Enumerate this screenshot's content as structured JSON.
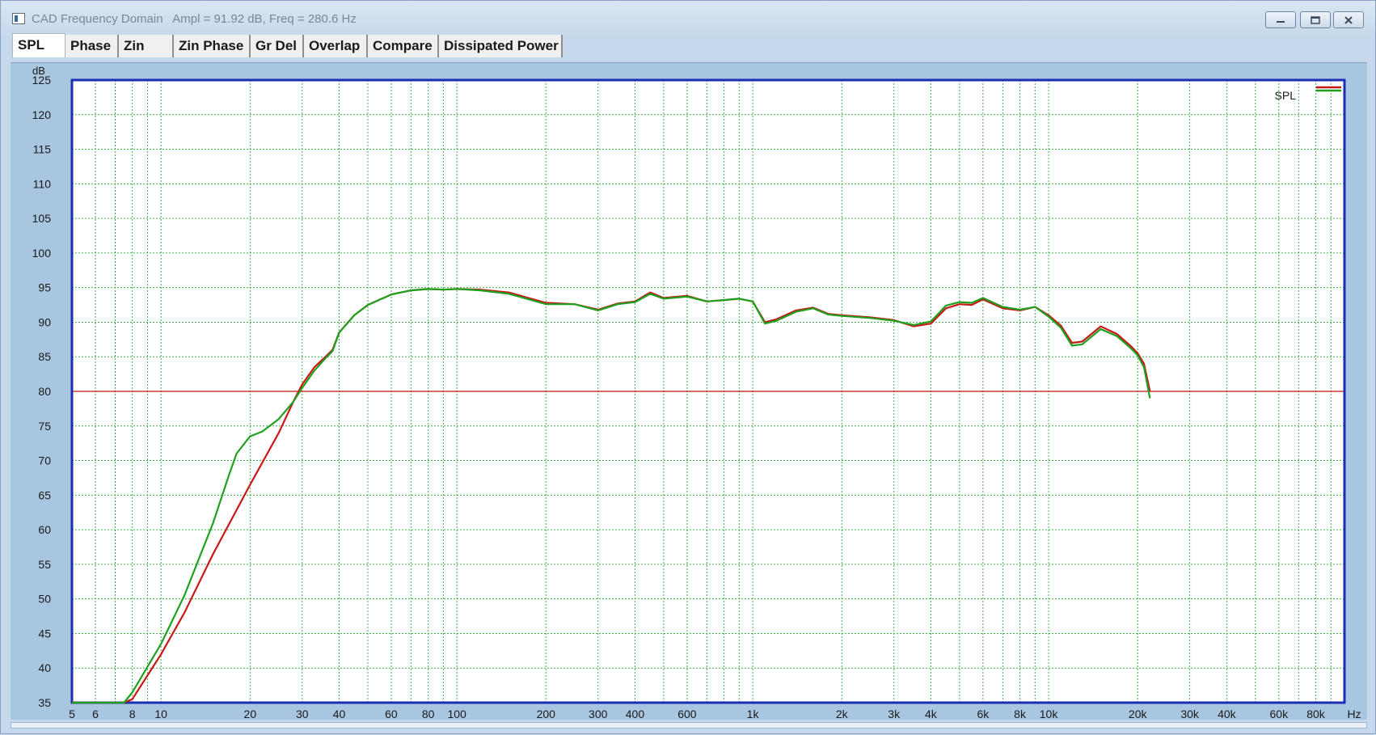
{
  "window": {
    "title": "CAD Frequency Domain   Ampl = 91.92 dB, Freq = 280.6 Hz"
  },
  "icons": {
    "app": "app-window-icon",
    "minimize": "minimize-icon",
    "maximize": "maximize-icon",
    "close": "close-icon"
  },
  "colors": {
    "background": "#a9c6e0",
    "grid": "#3cb043",
    "frame": "#1b2fb0",
    "reference_line": "#c01010",
    "series_red": "#c81818",
    "series_green": "#1fa01f"
  },
  "tabs": [
    {
      "label": "SPL",
      "active": true
    },
    {
      "label": "Phase",
      "active": false
    },
    {
      "label": "Zin",
      "active": false
    },
    {
      "label": "Zin Phase",
      "active": false
    },
    {
      "label": "Gr Del",
      "active": false
    },
    {
      "label": "Overlap",
      "active": false
    },
    {
      "label": "Compare",
      "active": false
    },
    {
      "label": "Dissipated Power",
      "active": false
    }
  ],
  "chart_data": {
    "type": "line",
    "title": "",
    "ylabel": "dB",
    "xlabel": "Hz",
    "x_scale": "log",
    "xlim": [
      5,
      100000
    ],
    "ylim": [
      35,
      125
    ],
    "grid": true,
    "legend_position": "top-right",
    "legend_label": "SPL",
    "x_ticks": [
      {
        "value": 5,
        "label": "5"
      },
      {
        "value": 6,
        "label": "6"
      },
      {
        "value": 8,
        "label": "8"
      },
      {
        "value": 10,
        "label": "10"
      },
      {
        "value": 20,
        "label": "20"
      },
      {
        "value": 30,
        "label": "30"
      },
      {
        "value": 40,
        "label": "40"
      },
      {
        "value": 60,
        "label": "60"
      },
      {
        "value": 80,
        "label": "80"
      },
      {
        "value": 100,
        "label": "100"
      },
      {
        "value": 200,
        "label": "200"
      },
      {
        "value": 300,
        "label": "300"
      },
      {
        "value": 400,
        "label": "400"
      },
      {
        "value": 600,
        "label": "600"
      },
      {
        "value": 1000,
        "label": "1k"
      },
      {
        "value": 2000,
        "label": "2k"
      },
      {
        "value": 3000,
        "label": "3k"
      },
      {
        "value": 4000,
        "label": "4k"
      },
      {
        "value": 6000,
        "label": "6k"
      },
      {
        "value": 8000,
        "label": "8k"
      },
      {
        "value": 10000,
        "label": "10k"
      },
      {
        "value": 20000,
        "label": "20k"
      },
      {
        "value": 30000,
        "label": "30k"
      },
      {
        "value": 40000,
        "label": "40k"
      },
      {
        "value": 60000,
        "label": "60k"
      },
      {
        "value": 80000,
        "label": "80k"
      }
    ],
    "y_ticks": [
      35,
      40,
      45,
      50,
      55,
      60,
      65,
      70,
      75,
      80,
      85,
      90,
      95,
      100,
      105,
      110,
      115,
      120,
      125
    ],
    "reference_line": {
      "y": 80
    },
    "series": [
      {
        "color": "#c81818",
        "points": [
          [
            5,
            35
          ],
          [
            7.5,
            35
          ],
          [
            8,
            35.5
          ],
          [
            10,
            42
          ],
          [
            12,
            48
          ],
          [
            15,
            56.5
          ],
          [
            20,
            66.5
          ],
          [
            25,
            74
          ],
          [
            28,
            78.5
          ],
          [
            30,
            81
          ],
          [
            33,
            83.5
          ],
          [
            36,
            85
          ],
          [
            38,
            86
          ],
          [
            40,
            88.5
          ],
          [
            45,
            91
          ],
          [
            50,
            92.5
          ],
          [
            60,
            94
          ],
          [
            70,
            94.6
          ],
          [
            80,
            94.8
          ],
          [
            90,
            94.7
          ],
          [
            100,
            94.8
          ],
          [
            120,
            94.7
          ],
          [
            150,
            94.3
          ],
          [
            200,
            92.8
          ],
          [
            250,
            92.6
          ],
          [
            300,
            91.8
          ],
          [
            350,
            92.7
          ],
          [
            400,
            93
          ],
          [
            450,
            94.3
          ],
          [
            500,
            93.5
          ],
          [
            600,
            93.8
          ],
          [
            700,
            93
          ],
          [
            800,
            93.2
          ],
          [
            900,
            93.4
          ],
          [
            1000,
            93
          ],
          [
            1100,
            90
          ],
          [
            1200,
            90.4
          ],
          [
            1400,
            91.7
          ],
          [
            1600,
            92.1
          ],
          [
            1800,
            91.2
          ],
          [
            2000,
            91
          ],
          [
            2500,
            90.7
          ],
          [
            3000,
            90.3
          ],
          [
            3500,
            89.4
          ],
          [
            4000,
            89.8
          ],
          [
            4500,
            92
          ],
          [
            5000,
            92.6
          ],
          [
            5500,
            92.5
          ],
          [
            6000,
            93.3
          ],
          [
            7000,
            92
          ],
          [
            8000,
            91.7
          ],
          [
            9000,
            92.2
          ],
          [
            10000,
            91
          ],
          [
            11000,
            89.5
          ],
          [
            12000,
            87
          ],
          [
            13000,
            87.2
          ],
          [
            15000,
            89.4
          ],
          [
            17000,
            88.3
          ],
          [
            19000,
            86.5
          ],
          [
            20000,
            85.5
          ],
          [
            21000,
            84
          ],
          [
            22000,
            80
          ]
        ]
      },
      {
        "color": "#1fa01f",
        "points": [
          [
            5,
            35
          ],
          [
            7.5,
            35
          ],
          [
            8,
            36.5
          ],
          [
            10,
            43.5
          ],
          [
            12,
            50.5
          ],
          [
            15,
            61
          ],
          [
            17,
            68
          ],
          [
            18,
            71
          ],
          [
            20,
            73.5
          ],
          [
            22,
            74.2
          ],
          [
            25,
            76
          ],
          [
            28,
            78.5
          ],
          [
            30,
            80.5
          ],
          [
            33,
            83
          ],
          [
            36,
            84.8
          ],
          [
            38,
            85.8
          ],
          [
            40,
            88.5
          ],
          [
            45,
            91
          ],
          [
            50,
            92.5
          ],
          [
            60,
            94
          ],
          [
            70,
            94.6
          ],
          [
            80,
            94.8
          ],
          [
            90,
            94.7
          ],
          [
            100,
            94.8
          ],
          [
            120,
            94.6
          ],
          [
            150,
            94.1
          ],
          [
            200,
            92.6
          ],
          [
            250,
            92.6
          ],
          [
            300,
            91.7
          ],
          [
            350,
            92.6
          ],
          [
            400,
            92.9
          ],
          [
            450,
            94.1
          ],
          [
            500,
            93.4
          ],
          [
            600,
            93.7
          ],
          [
            700,
            93
          ],
          [
            800,
            93.2
          ],
          [
            900,
            93.4
          ],
          [
            1000,
            93
          ],
          [
            1100,
            89.8
          ],
          [
            1200,
            90.2
          ],
          [
            1400,
            91.5
          ],
          [
            1600,
            92
          ],
          [
            1800,
            91.1
          ],
          [
            2000,
            90.9
          ],
          [
            2500,
            90.6
          ],
          [
            3000,
            90.2
          ],
          [
            3500,
            89.6
          ],
          [
            4000,
            90.1
          ],
          [
            4500,
            92.4
          ],
          [
            5000,
            92.9
          ],
          [
            5500,
            92.8
          ],
          [
            6000,
            93.5
          ],
          [
            7000,
            92.2
          ],
          [
            8000,
            91.8
          ],
          [
            9000,
            92.2
          ],
          [
            10000,
            90.8
          ],
          [
            11000,
            89.2
          ],
          [
            12000,
            86.6
          ],
          [
            13000,
            86.8
          ],
          [
            15000,
            89
          ],
          [
            17000,
            88
          ],
          [
            19000,
            86.2
          ],
          [
            20000,
            85.2
          ],
          [
            21000,
            83.5
          ],
          [
            22000,
            79
          ]
        ]
      }
    ]
  }
}
